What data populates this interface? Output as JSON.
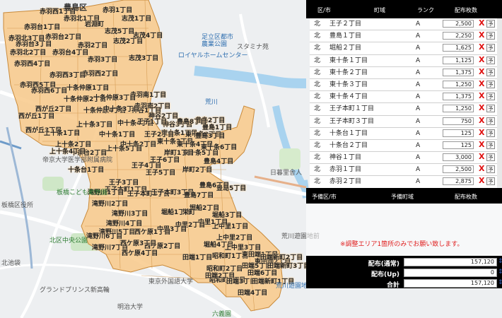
{
  "map": {
    "area_labels": [
      "赤羽西1丁目",
      "赤羽台1丁目",
      "赤羽台2丁目",
      "赤羽台3丁目",
      "赤羽台4丁目",
      "赤羽北3丁目",
      "赤羽北2丁目",
      "赤羽北1丁目",
      "赤羽1丁目",
      "赤羽2丁目",
      "赤羽3丁目",
      "赤羽南1丁目",
      "赤羽南2丁目",
      "赤羽西2丁目",
      "赤羽西3丁目",
      "赤羽西4丁目",
      "赤羽西5丁目",
      "赤羽西6丁目",
      "西が丘1丁目",
      "西が丘2丁目",
      "西が丘3丁目",
      "志茂1丁目",
      "志茂2丁目",
      "志茂3丁目",
      "志茂4丁目",
      "志茂5丁目",
      "岩淵町",
      "神谷1丁目",
      "神谷2丁目",
      "神谷3丁目",
      "十条仲原1丁目",
      "十条仲原2丁目",
      "十条仲原3丁目",
      "十条仲原4丁目",
      "十条台1丁目",
      "十条台2丁目",
      "中十条1丁目",
      "中十条2丁目",
      "中十条3丁目",
      "中十条4丁目",
      "上十条1丁目",
      "上十条2丁目",
      "上十条3丁目",
      "上十条4丁目",
      "上十条5丁目",
      "東十条1丁目",
      "東十条2丁目",
      "東十条3丁目",
      "東十条4丁目",
      "東十条5丁目",
      "東十条6丁目",
      "王子1丁目",
      "王子2丁目",
      "王子3丁目",
      "王子4丁目",
      "王子5丁目",
      "王子6丁目",
      "王子本町1丁目",
      "王子本町2丁目",
      "王子本町3丁目",
      "豊島1丁目",
      "豊島2丁目",
      "豊島3丁目",
      "豊島4丁目",
      "豊島5丁目",
      "豊島6丁目",
      "豊島7丁目",
      "豊島8丁目",
      "岸町1丁目",
      "岸町2丁目",
      "滝野川1丁目",
      "滝野川2丁目",
      "滝野川3丁目",
      "滝野川4丁目",
      "滝野川5丁目",
      "滝野川6丁目",
      "滝野川7丁目",
      "堀船1丁目",
      "堀船2丁目",
      "堀船3丁目",
      "堀船4丁目",
      "栄町",
      "上中里1丁目",
      "上中里2丁目",
      "上中里3丁目",
      "中里1丁目",
      "中里2丁目",
      "中里3丁目",
      "西ケ原1丁目",
      "西ケ原2丁目",
      "西ケ原3丁目",
      "西ケ原4丁目",
      "昭和町1丁目",
      "昭和町2丁目",
      "昭和町3丁目",
      "東田端1丁目",
      "東田端2丁目",
      "田端1丁目",
      "田端2丁目",
      "田端3丁目",
      "田端4丁目",
      "田端5丁目",
      "田端6丁目",
      "田端新町1丁目",
      "田端新町2丁目",
      "田端新町3丁目"
    ],
    "place_labels": [
      {
        "text": "豊島区",
        "style": "big"
      },
      {
        "text": "足立区都市",
        "style": "blue"
      },
      {
        "text": "農業公園",
        "style": "blue"
      },
      {
        "text": "スタミナ苑",
        "style": "plain"
      },
      {
        "text": "ロイヤルホームセンター",
        "style": "blue"
      },
      {
        "text": "荒川",
        "style": "blue"
      },
      {
        "text": "板橋区役所",
        "style": "plain"
      },
      {
        "text": "板橋こども動物園",
        "style": "green"
      },
      {
        "text": "帝京大学医学部附属病院",
        "style": "plain"
      },
      {
        "text": "東京外国語大学",
        "style": "plain"
      },
      {
        "text": "北区中央公園",
        "style": "green"
      },
      {
        "text": "荒川遊園地",
        "style": "blue"
      },
      {
        "text": "荒川遊園地前",
        "style": "plain"
      },
      {
        "text": "北池袋",
        "style": "plain"
      },
      {
        "text": "明治大学",
        "style": "plain"
      },
      {
        "text": "グランドプリンス新高輪",
        "style": "plain"
      },
      {
        "text": "六義園",
        "style": "green"
      },
      {
        "text": "日暮里舎人",
        "style": "plain"
      }
    ]
  },
  "table": {
    "headers": {
      "ward": "区/市",
      "town": "町域",
      "rank": "ランク",
      "qty": "配布枚数"
    },
    "rows": [
      {
        "ward": "北",
        "town": "王子２丁目",
        "rank": "A",
        "qty": "2,500"
      },
      {
        "ward": "北",
        "town": "豊島１丁目",
        "rank": "A",
        "qty": "2,250"
      },
      {
        "ward": "北",
        "town": "堀船２丁目",
        "rank": "A",
        "qty": "1,625"
      },
      {
        "ward": "北",
        "town": "東十条１丁目",
        "rank": "A",
        "qty": "1,125"
      },
      {
        "ward": "北",
        "town": "東十条２丁目",
        "rank": "A",
        "qty": "1,375"
      },
      {
        "ward": "北",
        "town": "東十条３丁目",
        "rank": "A",
        "qty": "1,250"
      },
      {
        "ward": "北",
        "town": "東十条４丁目",
        "rank": "A",
        "qty": "1,375"
      },
      {
        "ward": "北",
        "town": "王子本町１丁目",
        "rank": "A",
        "qty": "1,250"
      },
      {
        "ward": "北",
        "town": "王子本町３丁目",
        "rank": "A",
        "qty": "750"
      },
      {
        "ward": "北",
        "town": "十条台１丁目",
        "rank": "A",
        "qty": "125"
      },
      {
        "ward": "北",
        "town": "十条台２丁目",
        "rank": "A",
        "qty": "125"
      },
      {
        "ward": "北",
        "town": "神谷１丁目",
        "rank": "A",
        "qty": "3,000"
      },
      {
        "ward": "北",
        "town": "赤羽１丁目",
        "rank": "A",
        "qty": "2,500"
      },
      {
        "ward": "北",
        "town": "赤羽２丁目",
        "rank": "A",
        "qty": "2,875"
      },
      {
        "ward": "北",
        "town": "赤羽南１丁目",
        "rank": "A",
        "qty": "1,875"
      }
    ],
    "delete_mark": "X",
    "reserve_label": "予"
  },
  "sub_table": {
    "headers": {
      "ward": "予備区/市",
      "town": "予備町域",
      "qty": "配布枚数"
    }
  },
  "notice": "※調整エリア1箇所のみでお願い致します。",
  "totals": [
    {
      "label": "配布(通常)",
      "value": "157,120"
    },
    {
      "label": "配布(Up)",
      "value": "0"
    },
    {
      "label": "合計",
      "value": "157,120"
    }
  ],
  "colors": {
    "area_fill": "#f8c98a",
    "area_border": "#c98a3a",
    "accent_red": "#e01010"
  }
}
